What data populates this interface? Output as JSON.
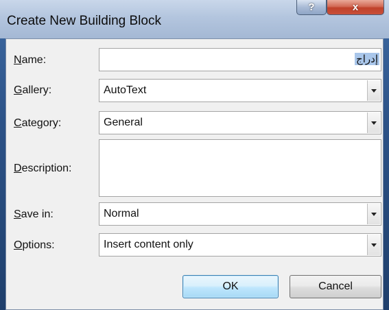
{
  "window": {
    "title": "Create New Building Block",
    "help_label": "?",
    "close_label": "x"
  },
  "form": {
    "name": {
      "label_u": "N",
      "label_rest": "ame:",
      "value": "إدراج"
    },
    "gallery": {
      "label_u": "G",
      "label_rest": "allery:",
      "value": "AutoText"
    },
    "category": {
      "label_u": "C",
      "label_rest": "ategory:",
      "value": "General"
    },
    "description": {
      "label_u": "D",
      "label_rest": "escription:",
      "value": ""
    },
    "save_in": {
      "label_u": "S",
      "label_rest": "ave in:",
      "value": "Normal"
    },
    "options": {
      "label_u": "O",
      "label_rest": "ptions:",
      "value": "Insert content only"
    }
  },
  "buttons": {
    "ok": "OK",
    "cancel": "Cancel"
  },
  "icons": {
    "dropdown": "chevron-down-icon"
  }
}
